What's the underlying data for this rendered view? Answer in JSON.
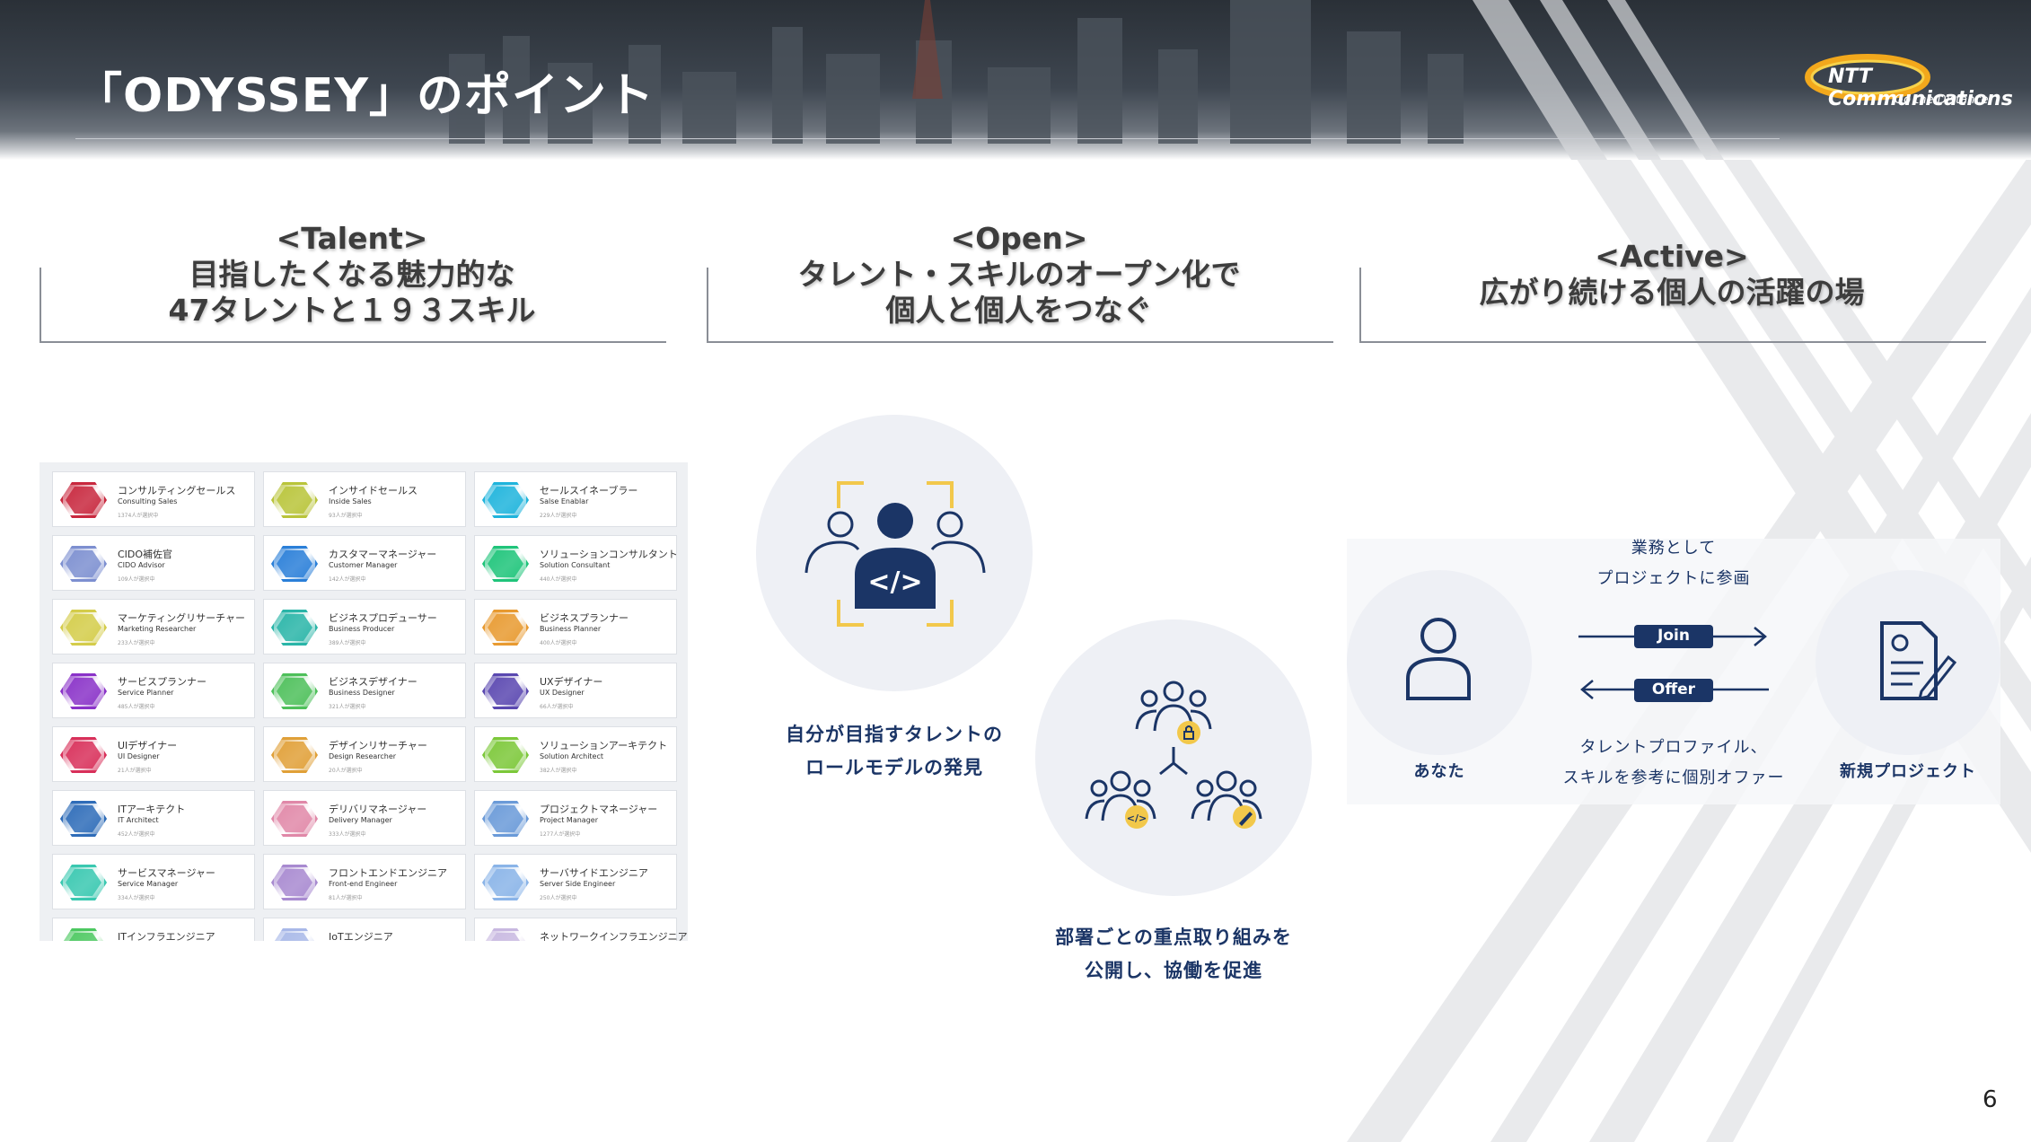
{
  "header": {
    "title": "「ODYSSEY」のポイント",
    "logo_text": "NTT Communications",
    "logo_tagline": "Go the Distance."
  },
  "columns": [
    {
      "heading_line1": "<Talent>",
      "heading_line2": "目指したくなる魅力的な",
      "heading_line3": "47タレントと１９３スキル"
    },
    {
      "heading_line1": "<Open>",
      "heading_line2": "タレント・スキルのオープン化で",
      "heading_line3": "個人と個人をつなぐ"
    },
    {
      "heading_line1": "<Active>",
      "heading_line2": "広がり続ける個人の活躍の場"
    }
  ],
  "talents": [
    {
      "jp": "コンサルティングセールス",
      "en": "Consulting Sales",
      "count": "1374人が選択中",
      "color": "#c8283e"
    },
    {
      "jp": "インサイドセールス",
      "en": "Inside Sales",
      "count": "93人が選択中",
      "color": "#b9c43a"
    },
    {
      "jp": "セールスイネーブラー",
      "en": "Salse Enablar",
      "count": "229人が選択中",
      "color": "#1fb4dc"
    },
    {
      "jp": "CIDO補佐官",
      "en": "CIDO Advisor",
      "count": "109人が選択中",
      "color": "#7d8fd0"
    },
    {
      "jp": "カスタマーマネージャー",
      "en": "Customer Manager",
      "count": "142人が選択中",
      "color": "#2a7fd8"
    },
    {
      "jp": "ソリューションコンサルタント",
      "en": "Solution Consultant",
      "count": "440人が選択中",
      "color": "#1fc47a"
    },
    {
      "jp": "マーケティングリサーチャー",
      "en": "Marketing Researcher",
      "count": "233人が選択中",
      "color": "#d4cc4a"
    },
    {
      "jp": "ビジネスプロデューサー",
      "en": "Business Producer",
      "count": "389人が選択中",
      "color": "#2ab5a8"
    },
    {
      "jp": "ビジネスプランナー",
      "en": "Business Planner",
      "count": "400人が選択中",
      "color": "#e89a30"
    },
    {
      "jp": "サービスプランナー",
      "en": "Service Planner",
      "count": "485人が選択中",
      "color": "#8a32c8"
    },
    {
      "jp": "ビジネスデザイナー",
      "en": "Business Designer",
      "count": "321人が選択中",
      "color": "#4ec05a"
    },
    {
      "jp": "UXデザイナー",
      "en": "UX Designer",
      "count": "66人が選択中",
      "color": "#5a48b0"
    },
    {
      "jp": "UIデザイナー",
      "en": "UI Designer",
      "count": "21人が選択中",
      "color": "#d8305a"
    },
    {
      "jp": "デザインリサーチャー",
      "en": "Design Researcher",
      "count": "20人が選択中",
      "color": "#e0a038"
    },
    {
      "jp": "ソリューションアーキテクト",
      "en": "Solution Architect",
      "count": "382人が選択中",
      "color": "#7cc83a"
    },
    {
      "jp": "ITアーキテクト",
      "en": "IT Architect",
      "count": "452人が選択中",
      "color": "#2e6cb8"
    },
    {
      "jp": "デリバリマネージャー",
      "en": "Delivery Manager",
      "count": "333人が選択中",
      "color": "#e088a8"
    },
    {
      "jp": "プロジェクトマネージャー",
      "en": "Project Manager",
      "count": "1277人が選択中",
      "color": "#6a9ad8"
    },
    {
      "jp": "サービスマネージャー",
      "en": "Service Manager",
      "count": "334人が選択中",
      "color": "#3ac8b0"
    },
    {
      "jp": "フロントエンドエンジニア",
      "en": "Front-end Engineer",
      "count": "81人が選択中",
      "color": "#a88ad0"
    },
    {
      "jp": "サーバサイドエンジニア",
      "en": "Server Side Engineer",
      "count": "250人が選択中",
      "color": "#8ab4e8"
    },
    {
      "jp": "ITインフラエンジニア",
      "en": "",
      "count": "",
      "color": "#4cc860"
    },
    {
      "jp": "IoTエンジニア",
      "en": "",
      "count": "",
      "color": "#a8b8e8"
    },
    {
      "jp": "ネットワークインフラエンジニア",
      "en": "",
      "count": "",
      "color": "#c8b8e0"
    }
  ],
  "open_section": {
    "caption1_line1": "自分が目指すタレントの",
    "caption1_line2": "ロールモデルの発見",
    "caption2_line1": "部署ごとの重点取り組みを",
    "caption2_line2": "公開し、協働を促進"
  },
  "active_section": {
    "you_label": "あなた",
    "project_label": "新規プロジェクト",
    "top_text_line1": "業務として",
    "top_text_line2": "プロジェクトに参画",
    "join_label": "Join",
    "offer_label": "Offer",
    "bottom_text_line1": "タレントプロファイル、",
    "bottom_text_line2": "スキルを参考に個別オファー"
  },
  "page_number": "6",
  "colors": {
    "navy": "#1b3566",
    "yellow": "#f2c84b",
    "gray_line": "#8a8e96"
  }
}
